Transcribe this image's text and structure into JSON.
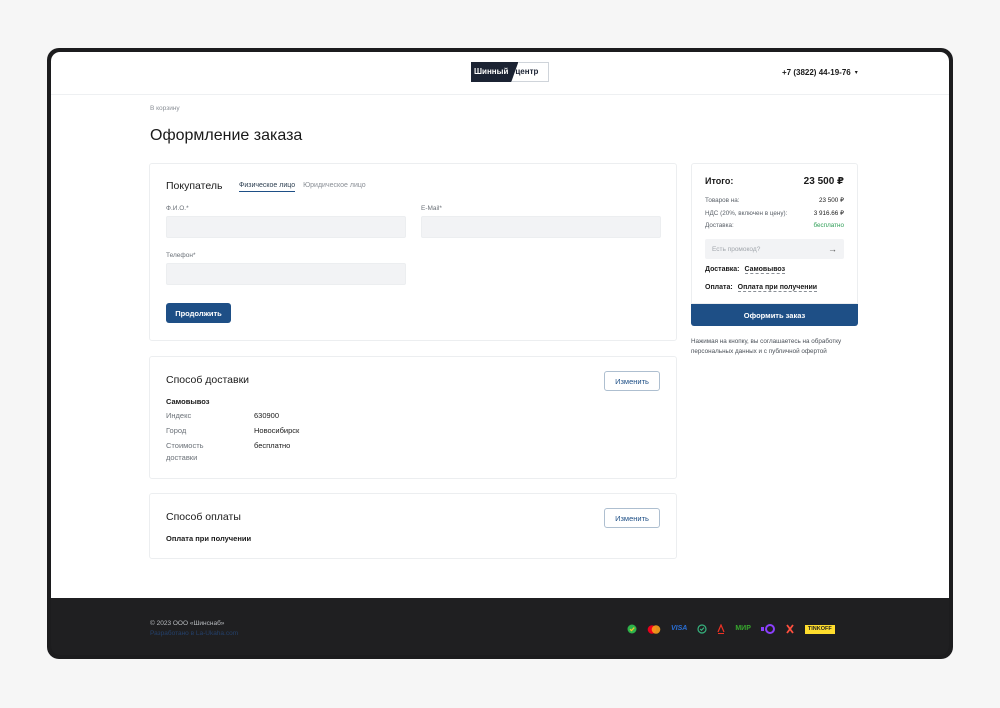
{
  "header": {
    "logo_dark": "Шинный",
    "logo_light": "центр",
    "phone": "+7 (3822) 44-19-76"
  },
  "breadcrumb": "В корзину",
  "page_title": "Оформление заказа",
  "buyer": {
    "title": "Покупатель",
    "tabs": [
      {
        "label": "Физическое лицо",
        "active": true
      },
      {
        "label": "Юридическое лицо",
        "active": false
      }
    ],
    "fields": {
      "name_label": "Ф.И.О.*",
      "email_label": "E-Mail*",
      "phone_label": "Телефон*",
      "name_value": "",
      "email_value": "",
      "phone_value": ""
    },
    "continue_label": "Продолжить"
  },
  "delivery": {
    "title": "Способ доставки",
    "change_label": "Изменить",
    "method": "Самовывоз",
    "rows": [
      {
        "key": "Индекс",
        "value": "630900"
      },
      {
        "key": "Город",
        "value": "Новосибирск"
      },
      {
        "key": "Стоимость доставки",
        "value": "бесплатно"
      }
    ]
  },
  "payment": {
    "title": "Способ оплаты",
    "change_label": "Изменить",
    "method": "Оплата при получении"
  },
  "summary": {
    "total_label": "Итого:",
    "total_value": "23 500 ₽",
    "rows": [
      {
        "key": "Товаров на:",
        "value": "23 500 ₽"
      },
      {
        "key": "НДС (20%, включен в цену):",
        "value": "3 916.66 ₽"
      },
      {
        "key": "Доставка:",
        "value": "бесплатно"
      }
    ],
    "promo_placeholder": "Есть промокод?",
    "delivery_label": "Доставка:",
    "delivery_value": "Самовывоз",
    "payment_label": "Оплата:",
    "payment_value": "Оплата при получении",
    "checkout_label": "Оформить заказ",
    "agree_text": "Нажимая на кнопку, вы соглашаетесь на обработку персональных данных и с публичной офертой"
  },
  "footer": {
    "copyright": "© 2023 ООО «Шинснаб»",
    "developer": "Разработано в La-Ukaha.com",
    "payment_icons": [
      "sberpay-icon",
      "mastercard-icon",
      "visa-icon",
      "sbp-icon",
      "alfa-icon",
      "mir-icon",
      "yoomoney-icon",
      "x-icon",
      "tinkoff-icon"
    ],
    "visa": "VISA",
    "mir": "МИР",
    "tinkoff": "TINKOFF"
  },
  "colors": {
    "accent": "#1e4f86",
    "green": "#2e9e56",
    "footer_bg": "#1f1f21"
  }
}
